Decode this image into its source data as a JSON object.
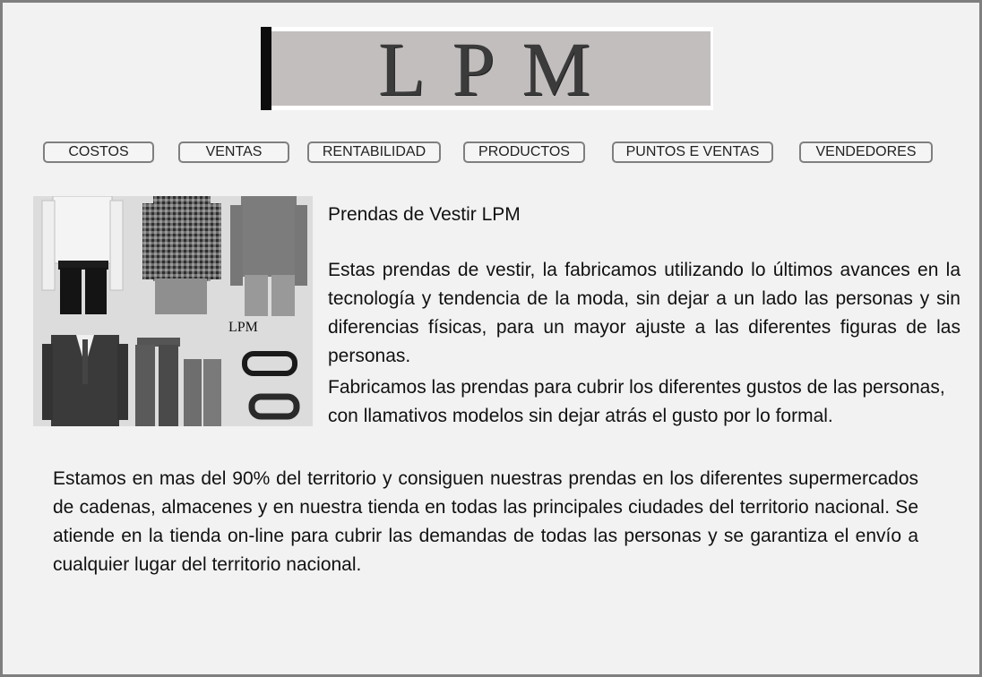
{
  "brand": {
    "logo_text": "LPM"
  },
  "nav": [
    {
      "label": "COSTOS"
    },
    {
      "label": "VENTAS"
    },
    {
      "label": "RENTABILIDAD"
    },
    {
      "label": "PRODUCTOS"
    },
    {
      "label": "PUNTOS E VENTAS"
    },
    {
      "label": "VENDEDORES"
    }
  ],
  "photo": {
    "caption": "LPM"
  },
  "content": {
    "title": "Prendas de Vestir LPM",
    "paragraph1": "Estas prendas de vestir, la fabricamos utilizando lo últimos avances en la tecnología y tendencia de la moda, sin dejar a un lado las personas y sin diferencias físicas, para un mayor ajuste a las diferentes figuras de las personas.",
    "paragraph2": "Fabricamos las prendas para cubrir los diferentes gustos de las personas, con llamativos modelos sin dejar atrás el gusto por lo formal.",
    "paragraph3": "Estamos en mas del 90% del territorio y consiguen nuestras prendas en los diferentes supermercados de cadenas, almacenes y en nuestra tienda en todas las principales ciudades del territorio nacional. Se atiende en la tienda on-line para cubrir las demandas de todas las personas y se garantiza el envío a cualquier lugar del territorio nacional."
  },
  "colors": {
    "background": "#f2f2f2",
    "border": "#7f7f7f",
    "logo_panel": "#c3bebe"
  }
}
